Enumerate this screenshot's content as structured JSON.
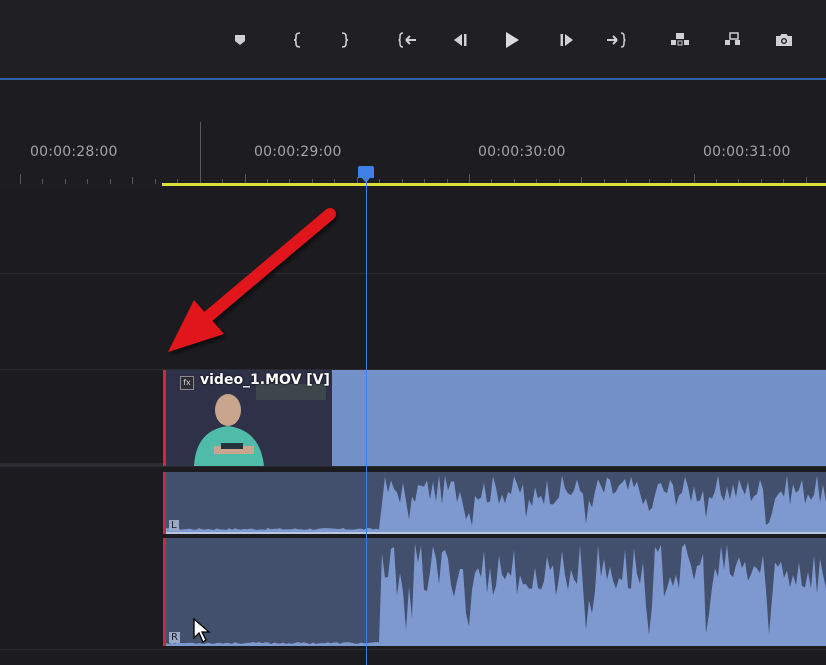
{
  "toolbar": {
    "buttons": [
      {
        "name": "add-marker-button",
        "icon": "marker-icon"
      },
      {
        "name": "mark-in-button",
        "icon": "mark-in-icon"
      },
      {
        "name": "mark-out-button",
        "icon": "mark-out-icon"
      },
      {
        "name": "go-to-in-button",
        "icon": "go-to-in-icon"
      },
      {
        "name": "step-back-button",
        "icon": "step-back-icon"
      },
      {
        "name": "play-button",
        "icon": "play-icon"
      },
      {
        "name": "step-forward-button",
        "icon": "step-forward-icon"
      },
      {
        "name": "go-to-out-button",
        "icon": "go-to-out-icon"
      },
      {
        "name": "lift-button",
        "icon": "lift-icon"
      },
      {
        "name": "extract-button",
        "icon": "extract-icon"
      },
      {
        "name": "export-frame-button",
        "icon": "camera-icon"
      }
    ]
  },
  "ruler": {
    "timecodes": [
      "00:00:28:00",
      "00:00:29:00",
      "00:00:30:00",
      "00:00:31:00"
    ]
  },
  "clip": {
    "title": "video_1.MOV [V]",
    "fx_badge": "fx"
  },
  "audio": {
    "left_label": "L",
    "right_label": "R"
  },
  "colors": {
    "accent": "#3f7fe8",
    "work_area": "#dede3a",
    "video_clip": "#7391c9",
    "audio_clip": "#42506d",
    "waveform": "#7d99cf",
    "clip_edge": "#d4234a",
    "arrow": "#e0131a"
  }
}
